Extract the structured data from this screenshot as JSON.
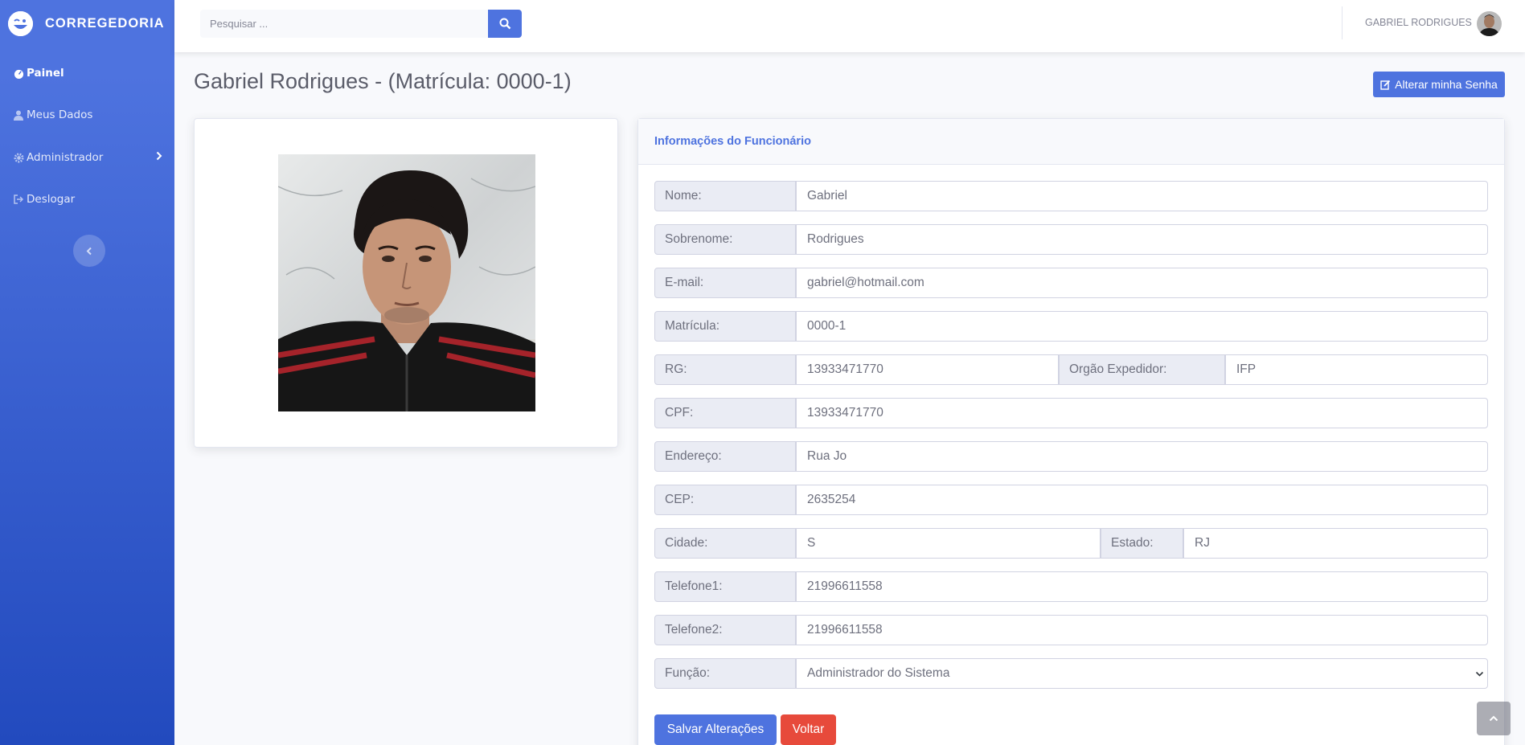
{
  "brand": {
    "name": "CORREGEDORIA"
  },
  "sidebar": {
    "items": [
      {
        "label": "Painel",
        "icon": "tachometer-icon"
      },
      {
        "label": "Meus Dados",
        "icon": "user-icon"
      },
      {
        "label": "Administrador",
        "icon": "gear-icon"
      },
      {
        "label": "Deslogar",
        "icon": "sign-out-icon"
      }
    ]
  },
  "topbar": {
    "search_placeholder": "Pesquisar ...",
    "user_name": "GABRIEL RODRIGUES"
  },
  "page": {
    "title": "Gabriel Rodrigues - (Matrícula: 0000-1)",
    "change_password_label": "Alterar minha Senha"
  },
  "card": {
    "header": "Informações do Funcionário"
  },
  "form": {
    "nome": {
      "label": "Nome:",
      "value": "Gabriel"
    },
    "sobrenome": {
      "label": "Sobrenome:",
      "value": "Rodrigues"
    },
    "email": {
      "label": "E-mail:",
      "value": "gabriel@hotmail.com"
    },
    "matricula": {
      "label": "Matrícula:",
      "value": "0000-1"
    },
    "rg": {
      "label": "RG:",
      "value": "13933471770"
    },
    "orgao": {
      "label": "Orgão Expedidor:",
      "value": "IFP"
    },
    "cpf": {
      "label": "CPF:",
      "value": "13933471770"
    },
    "endereco": {
      "label": "Endereço:",
      "value": "Rua Jo"
    },
    "cep": {
      "label": "CEP:",
      "value": "2635254"
    },
    "cidade": {
      "label": "Cidade:",
      "value": "S"
    },
    "estado": {
      "label": "Estado:",
      "value": "RJ"
    },
    "telefone1": {
      "label": "Telefone1:",
      "value": "21996611558"
    },
    "telefone2": {
      "label": "Telefone2:",
      "value": "21996611558"
    },
    "funcao": {
      "label": "Função:",
      "value": "Administrador do Sistema"
    }
  },
  "buttons": {
    "save": "Salvar Alterações",
    "back": "Voltar"
  },
  "colors": {
    "primary": "#4e73df",
    "danger": "#e74a3b",
    "sidebar_dark": "#224abe"
  }
}
